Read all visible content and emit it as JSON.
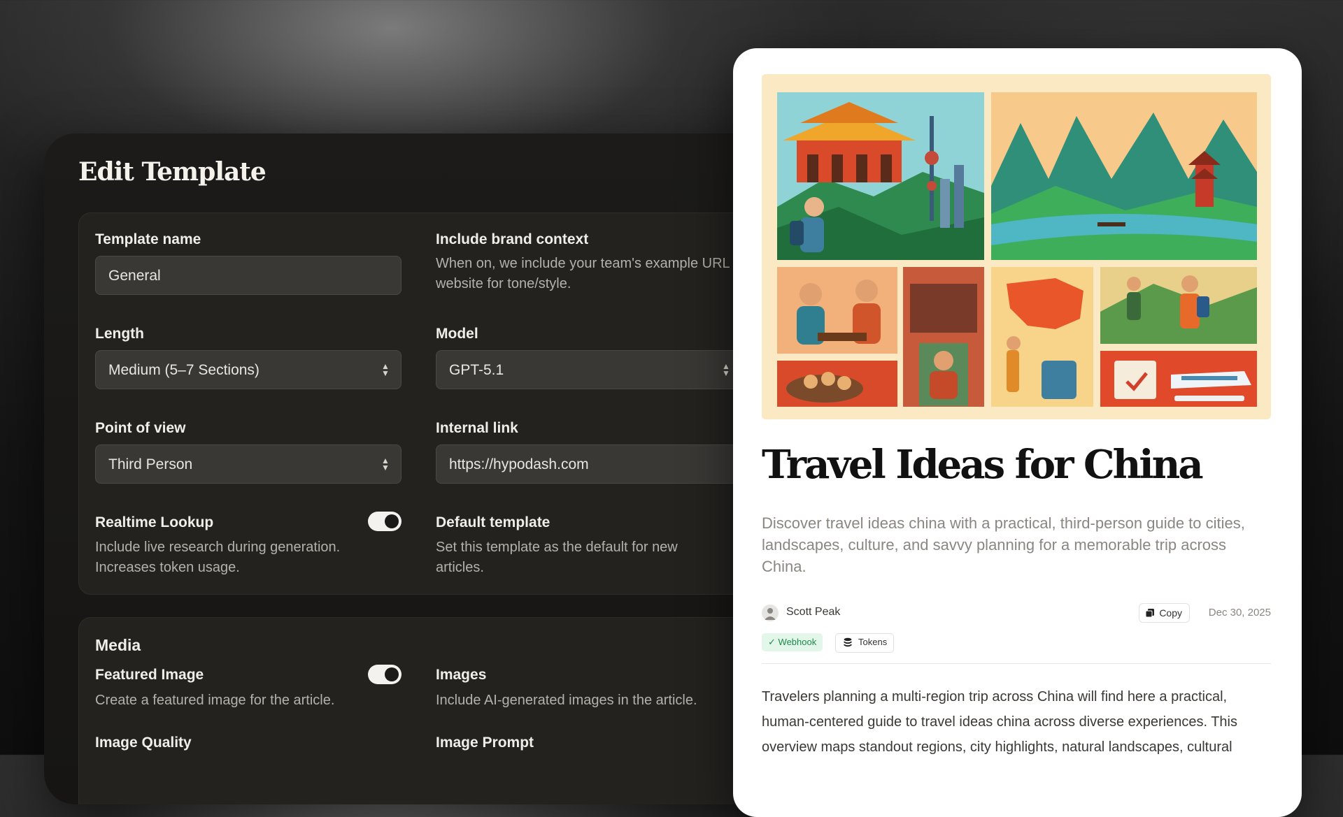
{
  "editor": {
    "title": "Edit Template",
    "template_name": {
      "label": "Template name",
      "value": "General"
    },
    "brand_context": {
      "label": "Include brand context",
      "help": "When on, we include your team's example URL and website for tone/style.",
      "enabled": true
    },
    "length": {
      "label": "Length",
      "value": "Medium (5–7 Sections)"
    },
    "model": {
      "label": "Model",
      "value": "GPT-5.1"
    },
    "point_of_view": {
      "label": "Point of view",
      "value": "Third Person"
    },
    "internal_link": {
      "label": "Internal link",
      "value": "https://hypodash.com"
    },
    "realtime_lookup": {
      "label": "Realtime Lookup",
      "help": "Include live research during generation. Increases token usage.",
      "enabled": true
    },
    "default_template": {
      "label": "Default template",
      "help": "Set this template as the default for new articles.",
      "enabled": true
    },
    "media": {
      "title": "Media",
      "featured_image": {
        "label": "Featured Image",
        "help": "Create a featured image for the article.",
        "enabled": true
      },
      "images": {
        "label": "Images",
        "help": "Include AI-generated images in the article.",
        "enabled": true
      },
      "image_quality_label": "Image Quality",
      "image_prompt_label": "Image Prompt"
    }
  },
  "article": {
    "title": "Travel Ideas for China",
    "lede": "Discover travel ideas china with a practical, third-person guide to cities, landscapes, culture, and savvy planning for a memorable trip across China.",
    "author": "Scott Peak",
    "copy_label": "Copy",
    "date": "Dec 30, 2025",
    "badges": {
      "webhook": "Webhook",
      "tokens": "Tokens"
    },
    "body": "Travelers planning a multi-region trip across China will find here a practical, human-centered guide to travel ideas china across diverse experiences. This overview maps standout regions, city highlights, natural landscapes, cultural"
  },
  "colors": {
    "panel_bg": "#1c1b19",
    "card_bg": "#23221f",
    "input_bg": "#393835",
    "webhook_badge": "#e3f6ea",
    "hero_bg": "#fbe9c4"
  }
}
